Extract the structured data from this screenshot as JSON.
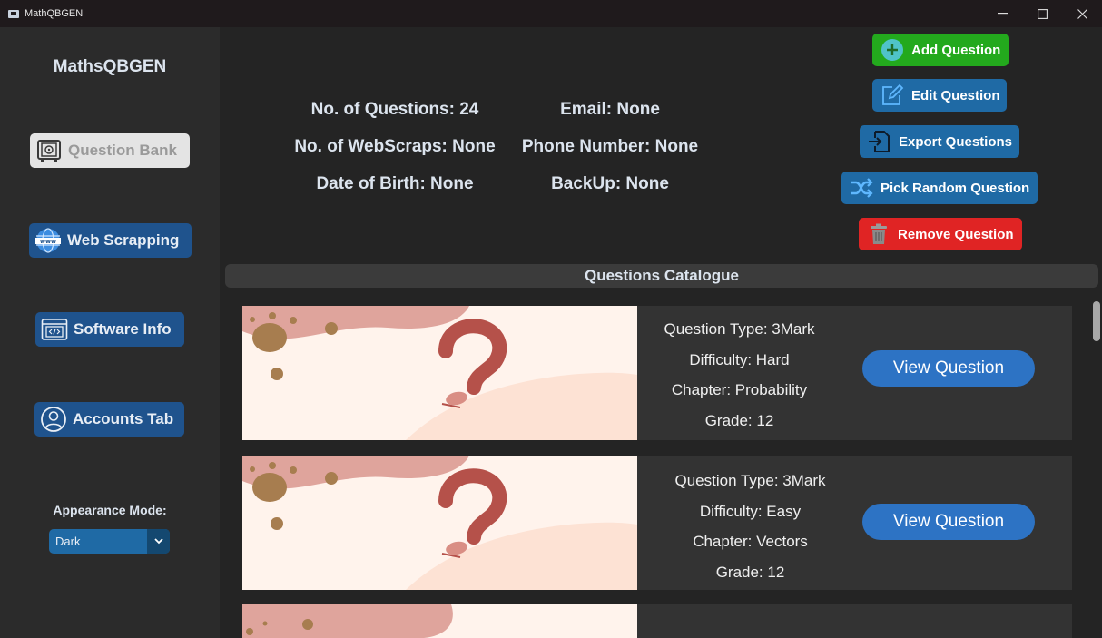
{
  "window": {
    "title": "MathQBGEN",
    "minimize_glyph": "—",
    "close_glyph": "✕"
  },
  "sidebar": {
    "brand": "MathsQBGEN",
    "items": [
      {
        "label": "Question Bank",
        "icon": "safe-icon"
      },
      {
        "label": "Web Scrapping",
        "icon": "globe-www-icon"
      },
      {
        "label": "Software Info",
        "icon": "code-window-icon"
      },
      {
        "label": "Accounts Tab",
        "icon": "user-icon"
      }
    ],
    "appearance_label": "Appearance Mode:",
    "appearance_value": "Dark",
    "appearance_arrow_glyph": "⌄"
  },
  "stats": {
    "questions": "No. of Questions: 24",
    "email": "Email: None",
    "webscraps": "No. of WebScraps: None",
    "phone": "Phone Number: None",
    "dob": "Date of Birth: None",
    "backup": "BackUp: None"
  },
  "actions": {
    "add": "Add Question",
    "edit": "Edit Question",
    "export": "Export Questions",
    "random": "Pick Random Question",
    "remove": "Remove Question"
  },
  "catalogue": {
    "header": "Questions Catalogue",
    "cards": [
      {
        "type": "Question Type: 3Mark",
        "difficulty": "Difficulty: Hard",
        "chapter": "Chapter: Probability",
        "grade": "Grade: 12",
        "button": "View Question"
      },
      {
        "type": "Question Type: 3Mark",
        "difficulty": "Difficulty: Easy",
        "chapter": "Chapter: Vectors",
        "grade": "Grade: 12",
        "button": "View Question"
      }
    ]
  },
  "colors": {
    "accent_blue": "#1f6aa5",
    "sidebar_button_blue": "#1f538d",
    "add_green": "#23a91d",
    "remove_red": "#e02424",
    "view_button_blue": "#2d73c4"
  }
}
